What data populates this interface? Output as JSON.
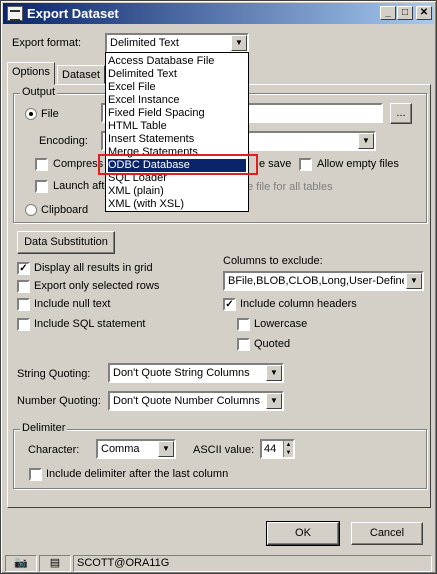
{
  "window": {
    "title": "Export Dataset"
  },
  "export_format": {
    "label": "Export format:",
    "value": "Delimited Text"
  },
  "tabs": [
    {
      "label": "Options"
    },
    {
      "label": "Dataset"
    }
  ],
  "output": {
    "group_title": "Output",
    "file_label": "File",
    "browse_label": "...",
    "encoding_label": "Encoding:",
    "compress_label": "Compress",
    "save_partial": "e save",
    "allow_empty_label": "Allow empty files",
    "launch_label": "Launch afte",
    "one_file_partial": "e file for all tables",
    "clipboard_label": "Clipboard"
  },
  "dropdown": {
    "options": [
      "Access Database File",
      "Delimited Text",
      "Excel File",
      "Excel Instance",
      "Fixed Field Spacing",
      "HTML Table",
      "Insert Statements",
      "Merge Statements",
      "ODBC Database",
      "SQL Loader",
      "XML (plain)",
      "XML (with XSL)"
    ],
    "selected": "ODBC Database"
  },
  "data_substitution": {
    "label": "Data Substitution"
  },
  "options": {
    "display_all": "Display all results in grid",
    "export_selected": "Export only selected rows",
    "include_null": "Include null text",
    "include_sql": "Include SQL statement"
  },
  "columns_exclude": {
    "label": "Columns to exclude:",
    "value": "BFile,BLOB,CLOB,Long,User-Defined",
    "include_headers": "Include column headers",
    "lowercase": "Lowercase",
    "quoted": "Quoted"
  },
  "string_quoting": {
    "label": "String Quoting:",
    "value": "Don't Quote String Columns"
  },
  "number_quoting": {
    "label": "Number Quoting:",
    "value": "Don't Quote Number Columns"
  },
  "delimiter": {
    "group_title": "Delimiter",
    "character_label": "Character:",
    "character_value": "Comma",
    "ascii_label": "ASCII value:",
    "ascii_value": "44",
    "include_after_last": "Include delimiter after the last column"
  },
  "buttons": {
    "ok": "OK",
    "cancel": "Cancel"
  },
  "statusbar": {
    "connection": "SCOTT@ORA11G"
  },
  "colors": {
    "selection": "#0a246a",
    "highlight_box": "#e02020",
    "titlebar": "#0a246a"
  }
}
